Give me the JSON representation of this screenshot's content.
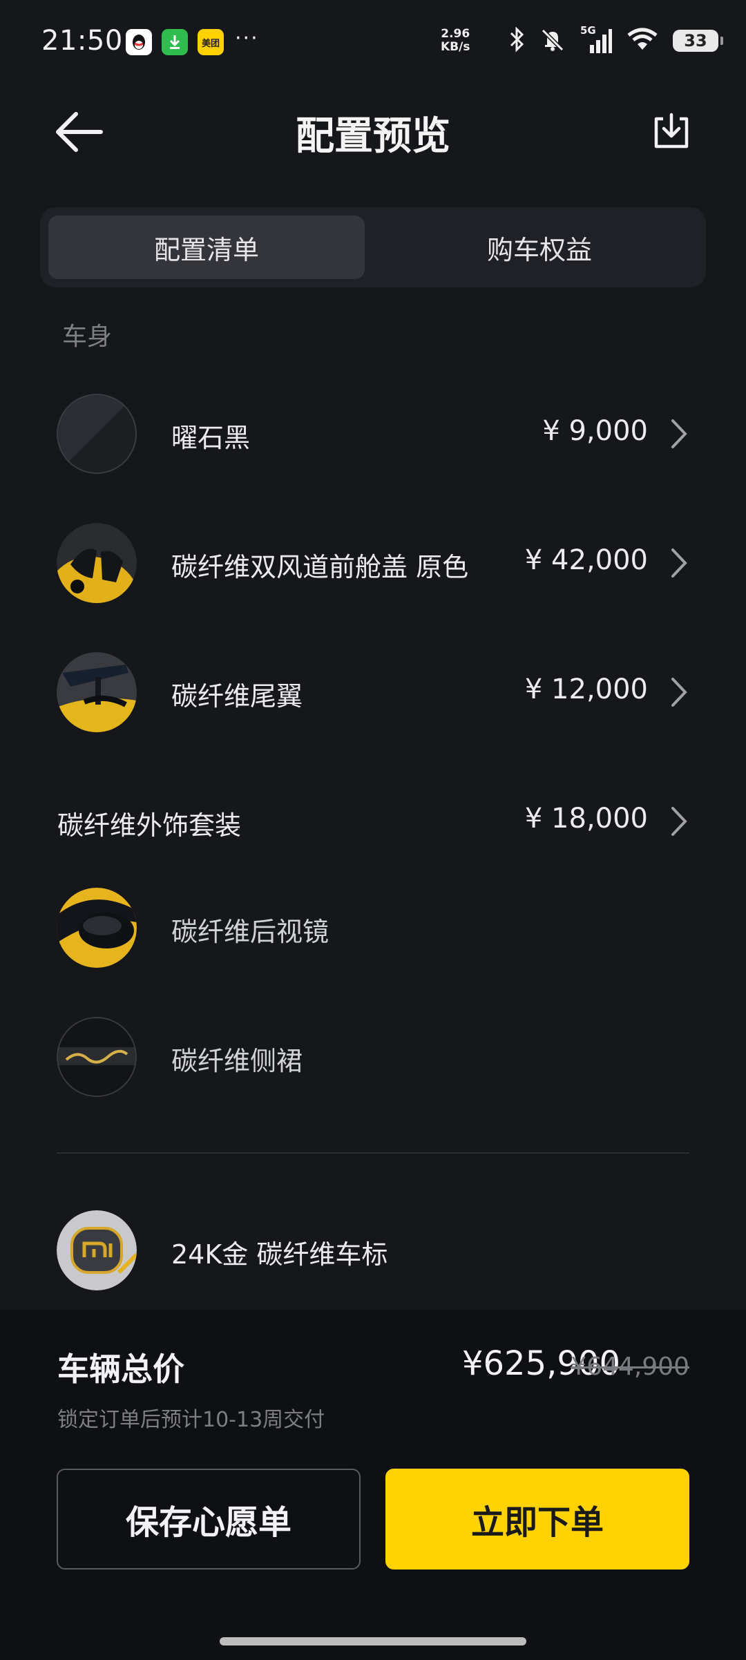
{
  "status_bar": {
    "time": "21:50",
    "apps": [
      "qq-icon",
      "download-app-icon",
      "meituan-icon"
    ],
    "meituan_label": "美团",
    "more": "···",
    "net_speed_value": "2.96",
    "net_speed_unit": "KB/s",
    "network": "5G",
    "battery": "33"
  },
  "header": {
    "title": "配置预览"
  },
  "tabs": [
    {
      "label": "配置清单",
      "active": true
    },
    {
      "label": "购车权益",
      "active": false
    }
  ],
  "section": {
    "label": "车身"
  },
  "items": [
    {
      "label": "曜石黑",
      "price": "¥ 9,000"
    },
    {
      "label": "碳纤维双风道前舱盖 原色",
      "price": "¥ 42,000"
    },
    {
      "label": "碳纤维尾翼",
      "price": "¥ 12,000"
    }
  ],
  "package": {
    "label": "碳纤维外饰套装",
    "price": "¥ 18,000",
    "items": [
      {
        "label": "碳纤维后视镜"
      },
      {
        "label": "碳纤维侧裙"
      }
    ]
  },
  "emblem": {
    "label": "24K金 碳纤维车标"
  },
  "bottom": {
    "total_label": "车辆总价",
    "total_price": "¥625,900",
    "original_price": "¥644,900",
    "delivery_note": "锁定订单后预计10-13周交付",
    "wishlist_button": "保存心愿单",
    "order_button": "立即下单"
  },
  "colors": {
    "background": "#16171b",
    "accent": "#ffd200",
    "bottom_panel": "#0f1013"
  }
}
